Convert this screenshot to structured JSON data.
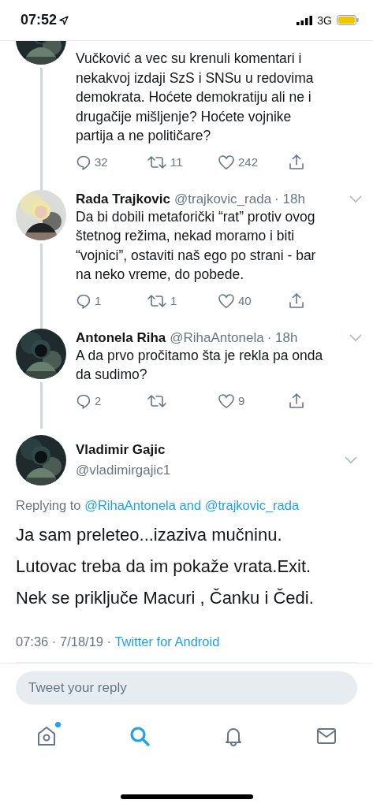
{
  "status_bar": {
    "time": "07:52",
    "network": "3G"
  },
  "thread": [
    {
      "partial": true,
      "text": "Vučković a vec su krenuli komentari i\nnekakvoj izdaji SzS i SNSu u redovima\ndemokrata. Hoćete demokratiju ali ne i\ndrugačije mišljenje? Hoćete vojnike\npartija a ne političare?",
      "replies": "32",
      "retweets": "11",
      "likes": "242"
    },
    {
      "partial": false,
      "name": "Rada Trajkovic",
      "handle": "@trajkovic_rada",
      "time": "· 18h",
      "text": "Da bi dobili metaforički “rat” protiv ovog\nštetnog režima, nekad moramo i biti\n“vojnici”, ostaviti naš ego po strani - bar\nna neko vreme, do pobede.",
      "replies": "1",
      "retweets": "1",
      "likes": "40"
    },
    {
      "partial": false,
      "name": "Antonela Riha",
      "handle": "@RihaAntonela",
      "time": "· 18h",
      "text": "A da prvo pročitamo šta je rekla pa onda\nda sudimo?",
      "replies": "2",
      "likes": "9"
    }
  ],
  "main_tweet": {
    "name": "Vladimir Gajic",
    "handle": "@vladimirgajic1",
    "replying_prefix": "Replying to",
    "mentions": [
      "@RihaAntonela",
      "@trajkovic_rada"
    ],
    "mention_joiner": "and",
    "text": "Ja sam preleteo...izaziva mučninu.\nLutovac treba da im pokaže vrata.Exit.\nNek se priključe Macuri , Čanku i Čedi.",
    "time": "07:36",
    "date": "· 7/18/19 ·",
    "source": "Twitter for Android"
  },
  "reply_field": {
    "placeholder": "Tweet your reply"
  },
  "nav": [
    {
      "kind": "home",
      "selected": false,
      "badge": true
    },
    {
      "kind": "search",
      "selected": true,
      "badge": false
    },
    {
      "kind": "notifications",
      "selected": false,
      "badge": false
    },
    {
      "kind": "messages",
      "selected": false,
      "badge": false
    }
  ]
}
